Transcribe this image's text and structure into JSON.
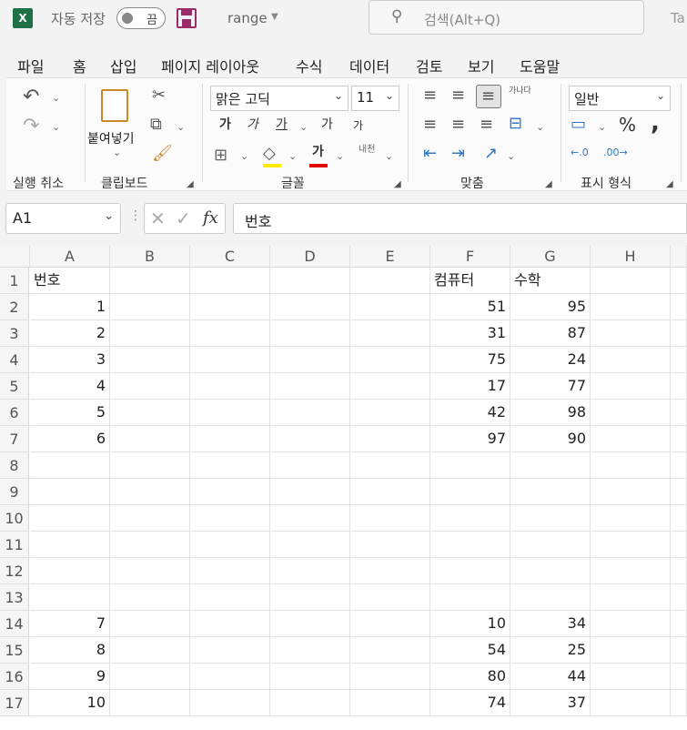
{
  "titlebar": {
    "logo_letter": "X",
    "autosave_label": "자동 저장",
    "autosave_state": "끔",
    "filename": "range",
    "search_placeholder": "검색(Alt+Q)",
    "user_initials": "Ta"
  },
  "tabs": [
    "파일",
    "홈",
    "삽입",
    "페이지 레이아웃",
    "수식",
    "데이터",
    "검토",
    "보기",
    "도움말"
  ],
  "active_tab": "홈",
  "ribbon": {
    "undo_group": "실행 취소",
    "clipboard_group": "클립보드",
    "paste_label": "붙여넣기",
    "font_group": "글꼴",
    "font_name": "맑은 고딕",
    "font_size": "11",
    "bold": "가",
    "italic": "가",
    "underline": "가",
    "grow_font": "가",
    "shrink_font": "가",
    "phonetic": "내천",
    "align_group": "맞춤",
    "wrap_label": "가나다",
    "number_group": "표시 형식",
    "number_format": "일반",
    "percent": "%",
    "comma": ","
  },
  "formula_bar": {
    "name_box": "A1",
    "fx": "fx",
    "content": "번호"
  },
  "accent_color": "#1e7145",
  "columns": [
    "A",
    "B",
    "C",
    "D",
    "E",
    "F",
    "G",
    "H"
  ],
  "rows": [
    {
      "n": "1",
      "A": "번호",
      "F": "컴퓨터",
      "G": "수학"
    },
    {
      "n": "2",
      "A": "1",
      "F": "51",
      "G": "95"
    },
    {
      "n": "3",
      "A": "2",
      "F": "31",
      "G": "87"
    },
    {
      "n": "4",
      "A": "3",
      "F": "75",
      "G": "24"
    },
    {
      "n": "5",
      "A": "4",
      "F": "17",
      "G": "77"
    },
    {
      "n": "6",
      "A": "5",
      "F": "42",
      "G": "98"
    },
    {
      "n": "7",
      "A": "6",
      "F": "97",
      "G": "90"
    },
    {
      "n": "8"
    },
    {
      "n": "9"
    },
    {
      "n": "10"
    },
    {
      "n": "11"
    },
    {
      "n": "12"
    },
    {
      "n": "13"
    },
    {
      "n": "14",
      "A": "7",
      "F": "10",
      "G": "34"
    },
    {
      "n": "15",
      "A": "8",
      "F": "54",
      "G": "25"
    },
    {
      "n": "16",
      "A": "9",
      "F": "80",
      "G": "44"
    },
    {
      "n": "17",
      "A": "10",
      "F": "74",
      "G": "37"
    }
  ]
}
